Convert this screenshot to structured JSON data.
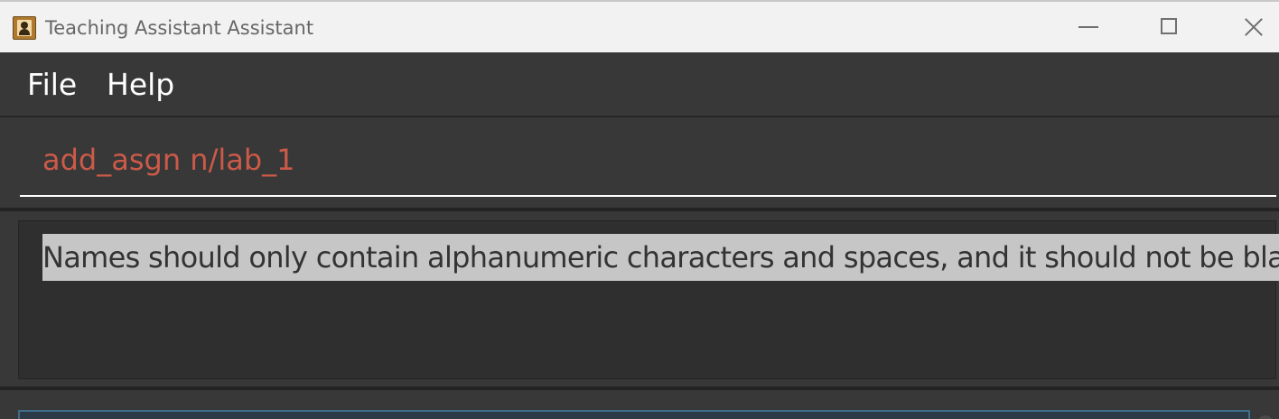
{
  "window": {
    "title": "Teaching Assistant Assistant",
    "icon": "contact-book-icon"
  },
  "window_controls": {
    "minimize_icon": "minimize-icon",
    "maximize_icon": "maximize-icon",
    "close_icon": "close-icon"
  },
  "menu": {
    "items": [
      {
        "label": "File"
      },
      {
        "label": "Help"
      }
    ]
  },
  "command": {
    "value": "add_asgn n/lab_1",
    "text_color": "#cc5a48"
  },
  "result": {
    "message": "Names should only contain alphanumeric characters and spaces, and it should not be blank"
  }
}
